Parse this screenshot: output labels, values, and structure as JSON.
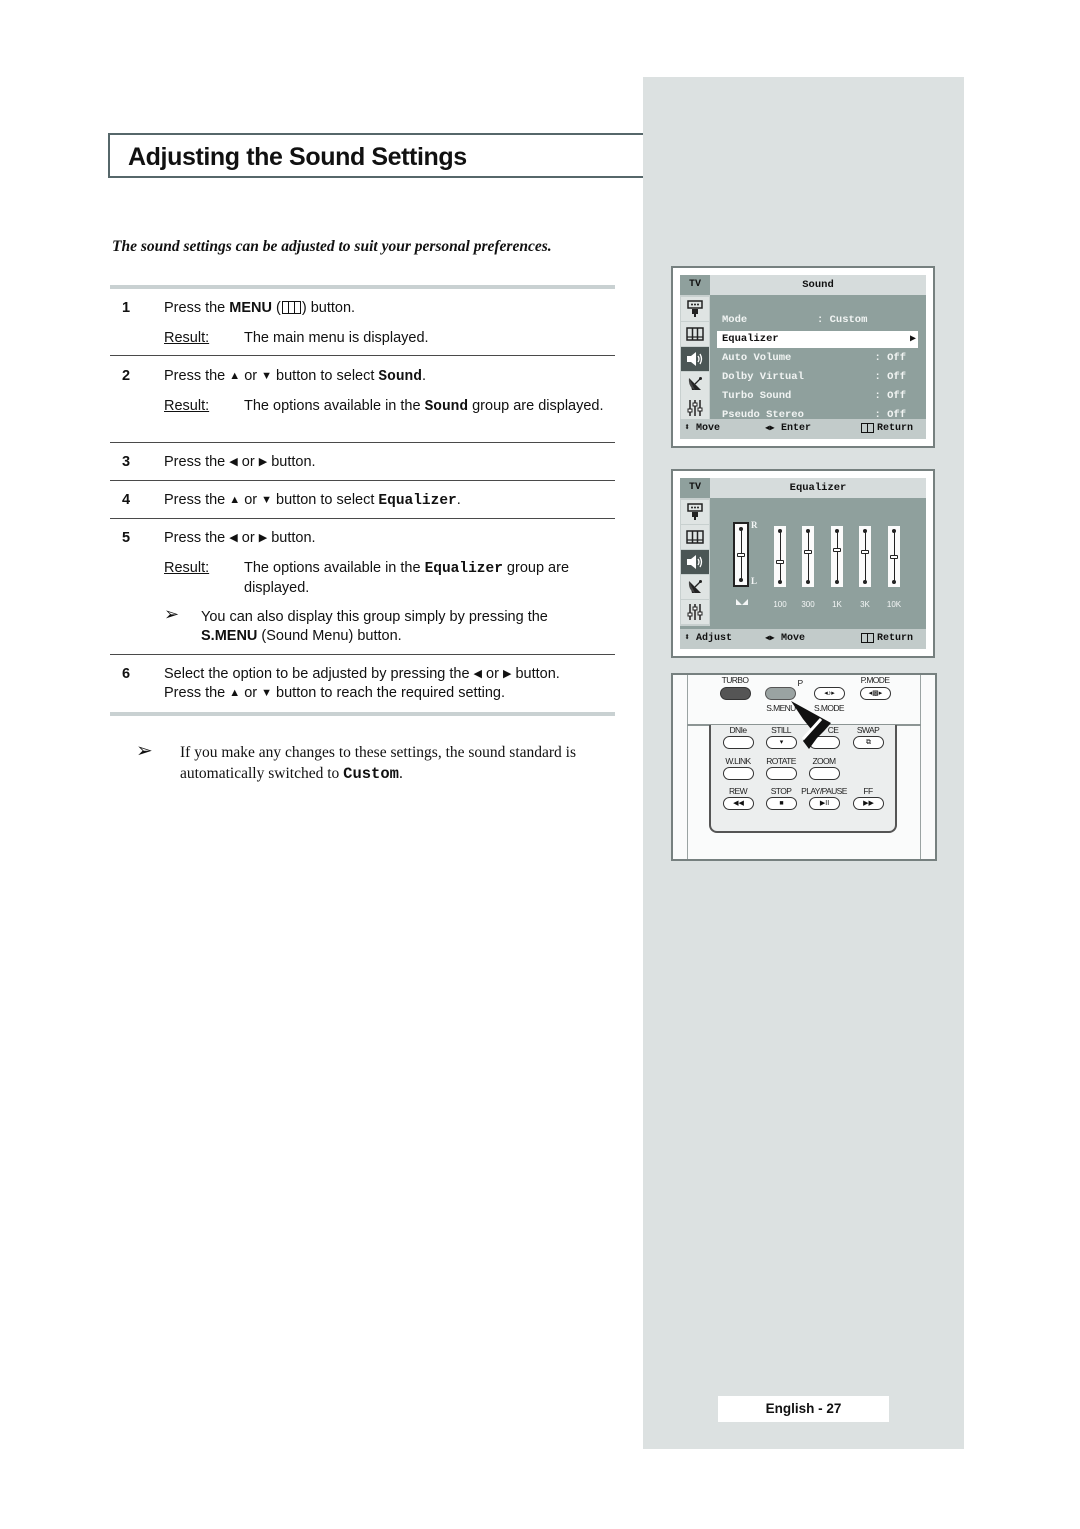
{
  "page": {
    "title": "Adjusting the Sound Settings",
    "subtitle": "The sound settings can be adjusted to suit your personal preferences.",
    "page_number": "English - 27"
  },
  "steps": [
    {
      "num": "1",
      "text_parts": [
        "Press the ",
        "MENU",
        " (",
        ") button."
      ],
      "icon": "menu-icon",
      "result_label": "Result:",
      "result": "The main menu is displayed."
    },
    {
      "num": "2",
      "text_parts": [
        "Press the ",
        "▲",
        " or ",
        "▼",
        " button to select ",
        "Sound",
        "."
      ],
      "result_label": "Result:",
      "result_parts": [
        "The options available in the ",
        "Sound",
        " group are displayed."
      ]
    },
    {
      "num": "3",
      "text_parts": [
        "Press the ",
        "◀",
        " or ",
        "▶",
        " button."
      ]
    },
    {
      "num": "4",
      "text_parts": [
        "Press the ",
        "▲",
        " or ",
        "▼",
        " button to select ",
        "Equalizer",
        "."
      ]
    },
    {
      "num": "5",
      "text_parts": [
        "Press the ",
        "◀",
        " or ",
        "▶",
        " button."
      ],
      "result_label": "Result:",
      "result_parts": [
        "The options available in the ",
        "Equalizer",
        " group are displayed."
      ],
      "note_arrow": "➢",
      "note_parts": [
        "You can also display this group simply by pressing the ",
        "S.MENU",
        " (Sound Menu) button."
      ]
    },
    {
      "num": "6",
      "text_line1_parts": [
        "Select the option to be adjusted by pressing the ",
        "◀",
        " or ",
        "▶",
        " button."
      ],
      "text_line2_parts": [
        "Press the ",
        "▲",
        " or ",
        "▼",
        " button to reach the required setting."
      ]
    }
  ],
  "final_note": {
    "arrow": "➢",
    "parts": [
      "If you make any changes to these settings, the sound standard is automatically switched to ",
      "Custom",
      "."
    ]
  },
  "sound_menu": {
    "tv_label": "TV",
    "title": "Sound",
    "icons": [
      "input-icon",
      "picture-icon",
      "sound-icon",
      "channel-icon",
      "setup-icon"
    ],
    "active_icon": 2,
    "items": [
      {
        "label": "Mode",
        "value": ": Custom",
        "selected": false
      },
      {
        "label": "Equalizer",
        "value": "",
        "arrow": "▶",
        "selected": true
      },
      {
        "label": "Auto Volume",
        "value": ": Off",
        "selected": false
      },
      {
        "label": "Dolby Virtual",
        "value": ": Off",
        "selected": false
      },
      {
        "label": "Turbo Sound",
        "value": ": Off",
        "selected": false
      },
      {
        "label": "Pseudo Stereo",
        "value": ": Off",
        "selected": false
      }
    ],
    "footer": {
      "move": "Move",
      "enter": "Enter",
      "return": "Return",
      "move_icon": "⬍",
      "enter_icon": "◀▶"
    }
  },
  "equalizer_menu": {
    "tv_label": "TV",
    "title": "Equalizer",
    "icons": [
      "input-icon",
      "picture-icon",
      "sound-icon",
      "channel-icon",
      "setup-icon"
    ],
    "active_icon": 2,
    "balance": {
      "label_top": "R",
      "label_bottom": "L",
      "level_percent": 50,
      "selected": true
    },
    "bands": [
      {
        "label": "100",
        "level_percent": 38
      },
      {
        "label": "300",
        "level_percent": 60
      },
      {
        "label": "1K",
        "level_percent": 64
      },
      {
        "label": "3K",
        "level_percent": 60
      },
      {
        "label": "10K",
        "level_percent": 50
      }
    ],
    "footer": {
      "adjust": "Adjust",
      "move": "Move",
      "return": "Return"
    }
  },
  "remote": {
    "top_labels": {
      "turbo": "TURBO",
      "p": "P",
      "pmode": "P.MODE",
      "smenu": "S.MENU",
      "smode": "S.MODE"
    },
    "rows": [
      [
        "DNIe",
        "STILL",
        "CE",
        "SWAP"
      ],
      [
        "W.LINK",
        "ROTATE",
        "ZOOM"
      ],
      [
        "REW",
        "STOP",
        "PLAY/PAUSE",
        "FF"
      ]
    ],
    "transport_glyphs": [
      "◀◀",
      "■",
      "▶II",
      "▶▶"
    ]
  }
}
